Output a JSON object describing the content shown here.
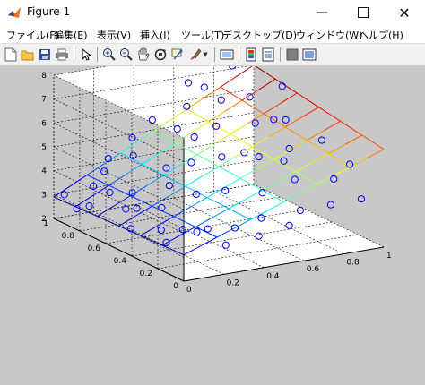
{
  "window": {
    "title": "Figure 1"
  },
  "menu": [
    {
      "label": "ファイル(F)"
    },
    {
      "label": "編集(E)"
    },
    {
      "label": "表示(V)"
    },
    {
      "label": "挿入(I)"
    },
    {
      "label": "ツール(T)"
    },
    {
      "label": "デスクトップ(D)"
    },
    {
      "label": "ウィンドウ(W)"
    },
    {
      "label": "ヘルプ(H)"
    }
  ],
  "toolbar": {
    "icons": [
      "new-figure-icon",
      "open-file-icon",
      "save-icon",
      "print-icon",
      "pointer-icon",
      "zoom-in-icon",
      "zoom-out-icon",
      "pan-icon",
      "rotate-icon",
      "data-cursor-icon",
      "brush-icon",
      "brush-dropdown-icon",
      "link-plot-icon",
      "colorbar-icon",
      "legend-icon",
      "hide-plot-tools-icon",
      "show-plot-tools-icon"
    ]
  },
  "chart_data": {
    "type": "scatter",
    "title": "",
    "xlabel": "",
    "ylabel": "",
    "zlabel": "",
    "xlim": [
      0,
      1
    ],
    "ylim": [
      0,
      1
    ],
    "zlim": [
      2,
      8
    ],
    "x_ticks": [
      "0",
      "0.2",
      "0.4",
      "0.6",
      "0.8",
      "1"
    ],
    "y_ticks": [
      "0",
      "0.2",
      "0.4",
      "0.6",
      "0.8",
      "1"
    ],
    "z_ticks": [
      "2",
      "3",
      "4",
      "5",
      "6",
      "7",
      "8"
    ],
    "grid": true,
    "surface": {
      "type": "mesh-plane",
      "z_at_corners": {
        "x0y0": 3.1,
        "x1y0": 6.1,
        "x0y1": 2.9,
        "x1y1": 7.0
      },
      "colormap": "jet"
    },
    "points": [
      {
        "x": 0.02,
        "y": 0.95,
        "z": 3.1
      },
      {
        "x": 0.05,
        "y": 0.9,
        "z": 2.6
      },
      {
        "x": 0.08,
        "y": 0.85,
        "z": 2.8
      },
      {
        "x": 0.12,
        "y": 0.88,
        "z": 3.5
      },
      {
        "x": 0.15,
        "y": 0.8,
        "z": 3.4
      },
      {
        "x": 0.2,
        "y": 0.92,
        "z": 3.9
      },
      {
        "x": 0.22,
        "y": 0.7,
        "z": 2.9
      },
      {
        "x": 0.25,
        "y": 0.78,
        "z": 3.3
      },
      {
        "x": 0.28,
        "y": 0.6,
        "z": 3.1
      },
      {
        "x": 0.3,
        "y": 0.85,
        "z": 4.6
      },
      {
        "x": 0.32,
        "y": 0.5,
        "z": 2.4
      },
      {
        "x": 0.35,
        "y": 0.65,
        "z": 3.8
      },
      {
        "x": 0.38,
        "y": 0.4,
        "z": 2.6
      },
      {
        "x": 0.4,
        "y": 0.75,
        "z": 4.2
      },
      {
        "x": 0.42,
        "y": 0.55,
        "z": 3.6
      },
      {
        "x": 0.45,
        "y": 0.3,
        "z": 2.8
      },
      {
        "x": 0.48,
        "y": 0.68,
        "z": 4.5
      },
      {
        "x": 0.5,
        "y": 0.45,
        "z": 3.9
      },
      {
        "x": 0.52,
        "y": 0.85,
        "z": 5.4
      },
      {
        "x": 0.55,
        "y": 0.25,
        "z": 3.2
      },
      {
        "x": 0.58,
        "y": 0.6,
        "z": 4.8
      },
      {
        "x": 0.6,
        "y": 0.9,
        "z": 6.1
      },
      {
        "x": 0.62,
        "y": 0.35,
        "z": 3.9
      },
      {
        "x": 0.65,
        "y": 0.75,
        "z": 5.6
      },
      {
        "x": 0.68,
        "y": 0.15,
        "z": 3.6
      },
      {
        "x": 0.7,
        "y": 0.5,
        "z": 4.9
      },
      {
        "x": 0.72,
        "y": 0.95,
        "z": 6.6
      },
      {
        "x": 0.75,
        "y": 0.3,
        "z": 4.4
      },
      {
        "x": 0.78,
        "y": 0.65,
        "z": 5.8
      },
      {
        "x": 0.8,
        "y": 0.1,
        "z": 3.8
      },
      {
        "x": 0.82,
        "y": 0.45,
        "z": 5.2
      },
      {
        "x": 0.85,
        "y": 0.8,
        "z": 6.4
      },
      {
        "x": 0.88,
        "y": 0.2,
        "z": 4.5
      },
      {
        "x": 0.9,
        "y": 0.6,
        "z": 5.9
      },
      {
        "x": 0.92,
        "y": 0.05,
        "z": 4.0
      },
      {
        "x": 0.95,
        "y": 0.4,
        "z": 5.5
      },
      {
        "x": 0.98,
        "y": 0.75,
        "z": 6.8
      },
      {
        "x": 0.1,
        "y": 0.6,
        "z": 3.3
      },
      {
        "x": 0.18,
        "y": 0.45,
        "z": 2.7
      },
      {
        "x": 0.26,
        "y": 0.3,
        "z": 2.9
      },
      {
        "x": 0.34,
        "y": 0.2,
        "z": 2.5
      },
      {
        "x": 0.44,
        "y": 0.1,
        "z": 3.0
      },
      {
        "x": 0.56,
        "y": 0.05,
        "z": 3.4
      },
      {
        "x": 0.66,
        "y": 0.55,
        "z": 5.0
      },
      {
        "x": 0.74,
        "y": 0.85,
        "z": 6.3
      },
      {
        "x": 0.86,
        "y": 0.95,
        "z": 7.3
      },
      {
        "x": 0.94,
        "y": 0.9,
        "z": 7.6
      },
      {
        "x": 0.46,
        "y": 0.95,
        "z": 5.6
      },
      {
        "x": 0.36,
        "y": 0.95,
        "z": 5.0
      },
      {
        "x": 0.14,
        "y": 0.35,
        "z": 2.5
      },
      {
        "x": 0.06,
        "y": 0.5,
        "z": 2.8
      },
      {
        "x": 0.64,
        "y": 0.95,
        "z": 6.9
      },
      {
        "x": 0.76,
        "y": 0.4,
        "z": 4.9
      },
      {
        "x": 0.84,
        "y": 0.6,
        "z": 6.0
      },
      {
        "x": 0.54,
        "y": 0.75,
        "z": 5.3
      },
      {
        "x": 0.24,
        "y": 0.95,
        "z": 4.3
      },
      {
        "x": 0.96,
        "y": 0.2,
        "z": 5.0
      }
    ]
  }
}
